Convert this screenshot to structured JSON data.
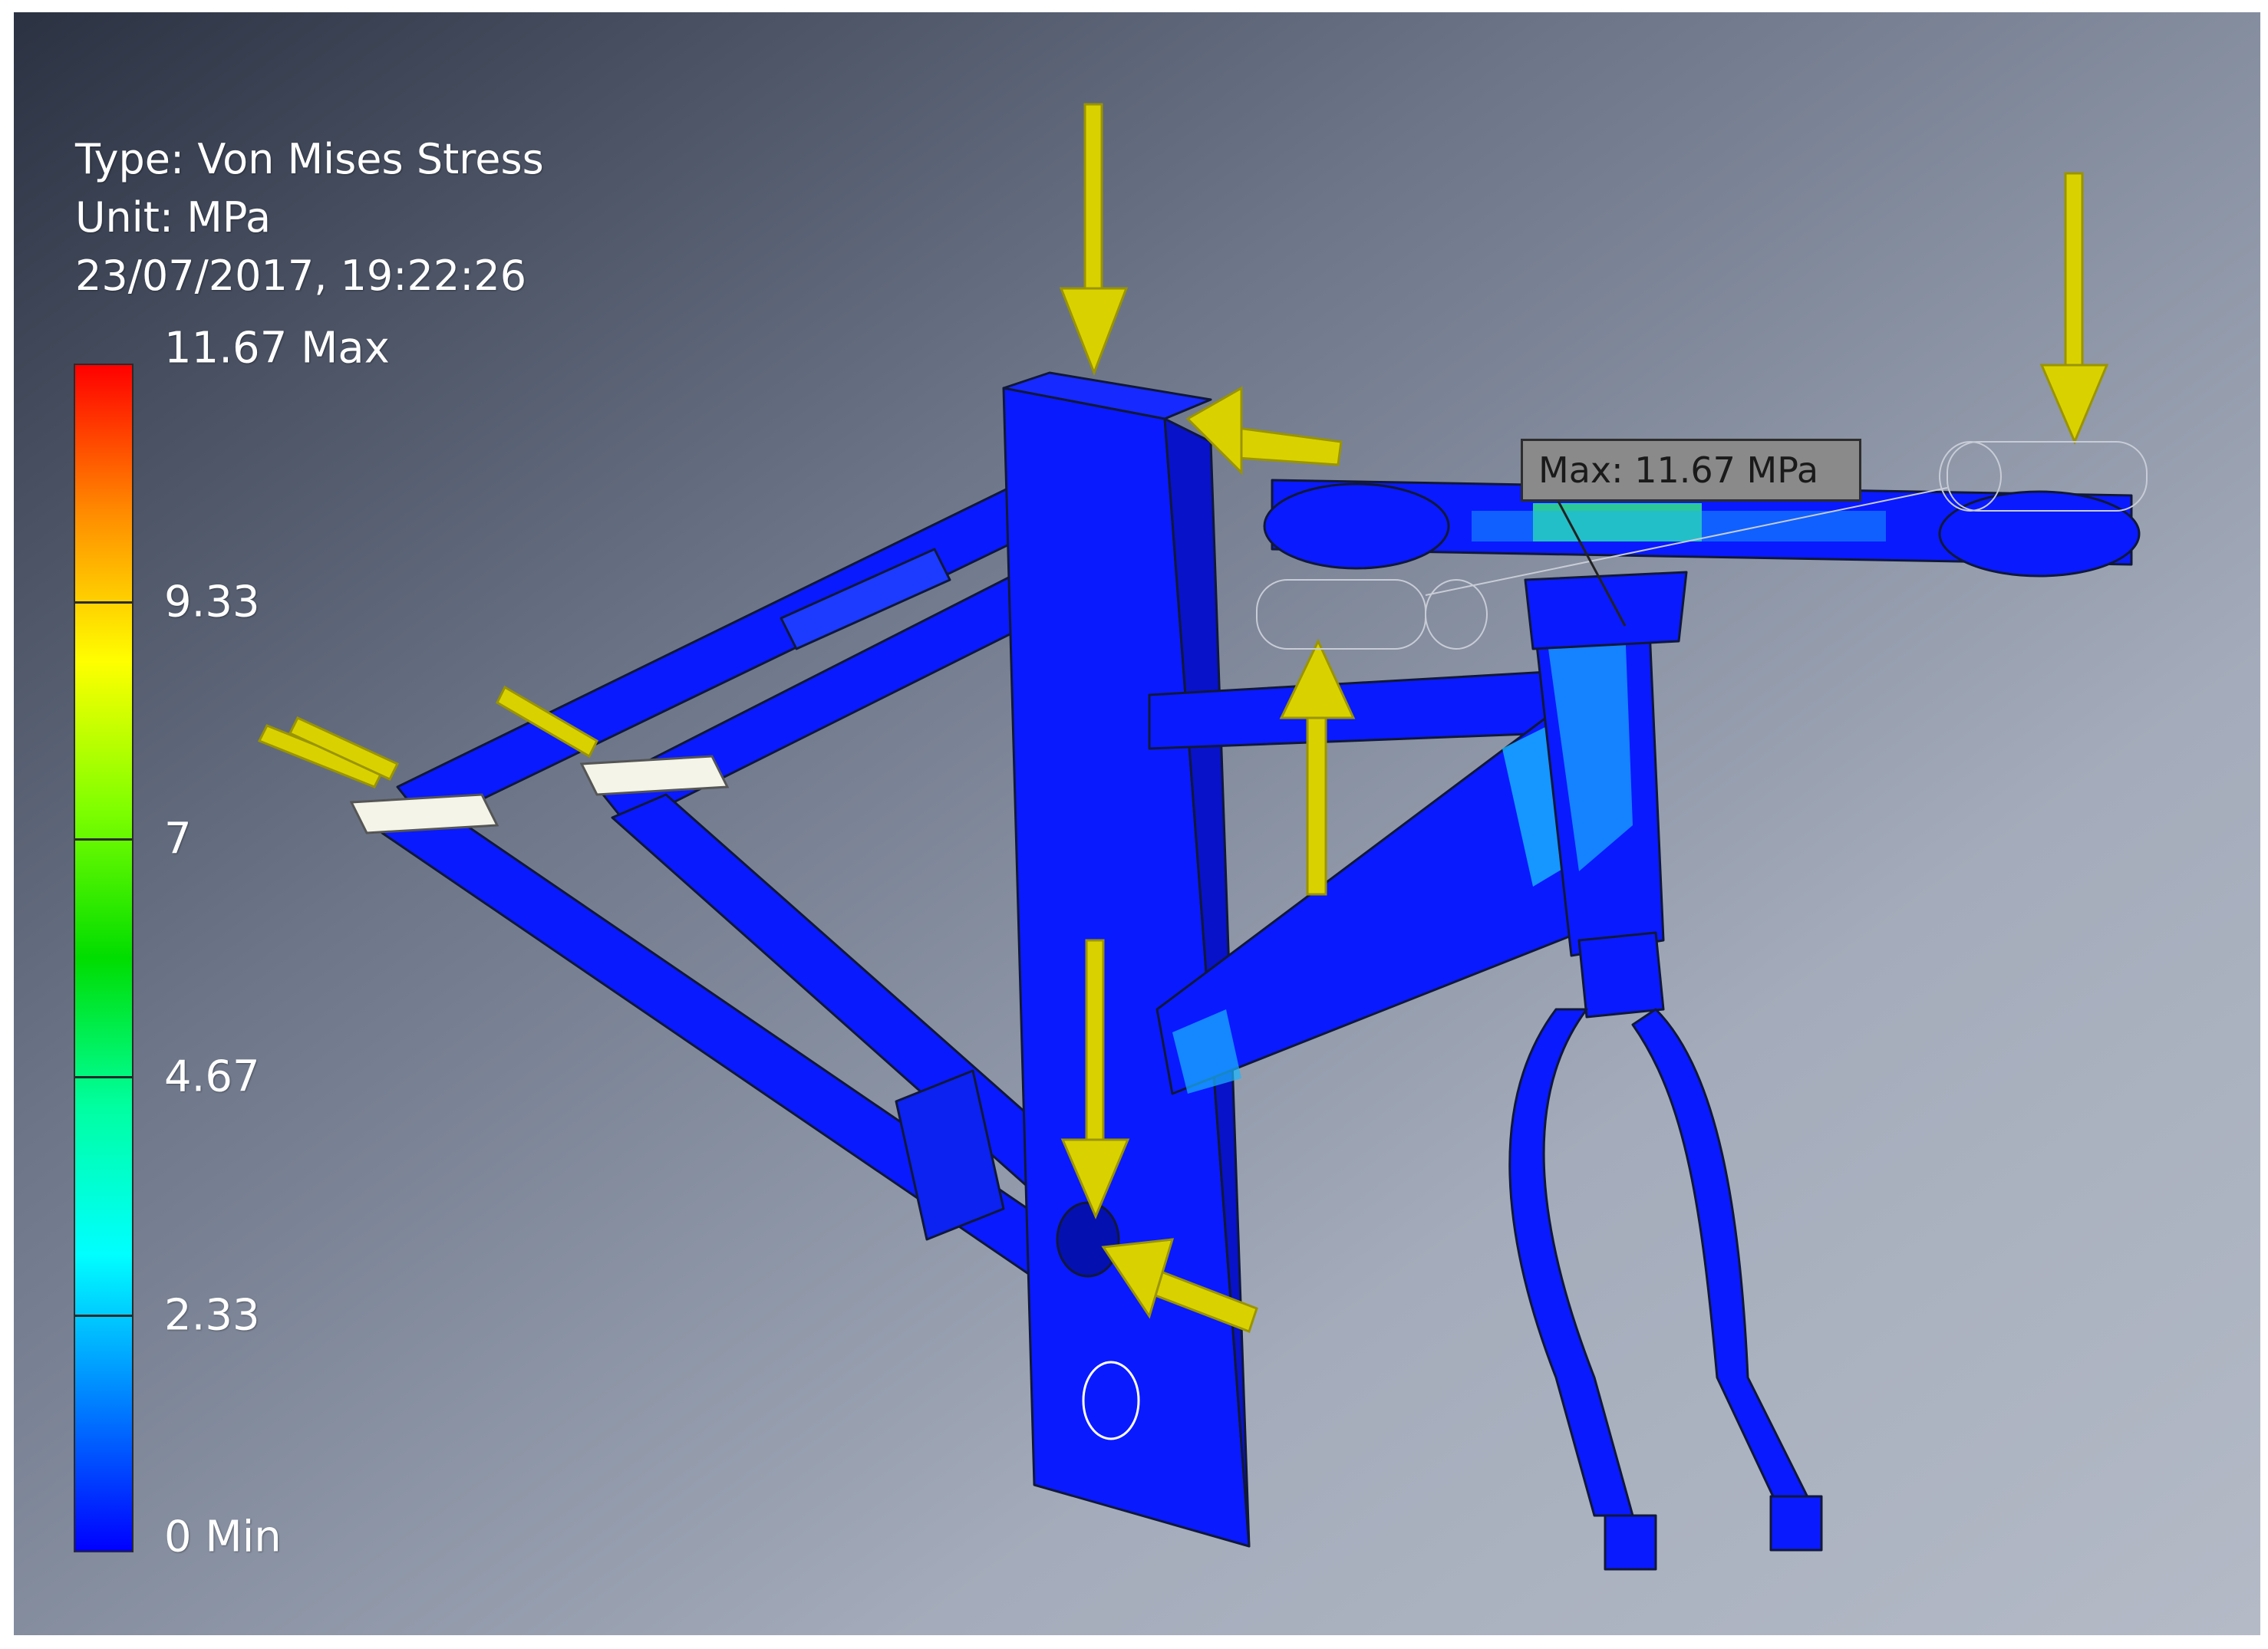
{
  "legend": {
    "type_line": "Type: Von Mises Stress",
    "unit_line": "Unit: MPa",
    "timestamp": "23/07/2017, 19:22:26",
    "ticks": [
      {
        "label": "11.67 Max",
        "value": 11.67
      },
      {
        "label": "9.33",
        "value": 9.33
      },
      {
        "label": "7",
        "value": 7
      },
      {
        "label": "4.67",
        "value": 4.67
      },
      {
        "label": "2.33",
        "value": 2.33
      },
      {
        "label": "0 Min",
        "value": 0
      }
    ],
    "colors": [
      "#ff0000",
      "#ff8c00",
      "#ffff00",
      "#7fff00",
      "#00dd00",
      "#00ffa0",
      "#00ffff",
      "#0080ff",
      "#0000ff"
    ]
  },
  "probe": {
    "label": "Max: 11.67 MPa"
  },
  "model_colors": {
    "body": "#0a1aff",
    "highlight": "#19b6ff",
    "hotspot": "#33e68a",
    "arrow": "#d9d200",
    "arrow_dark": "#9a9400"
  }
}
